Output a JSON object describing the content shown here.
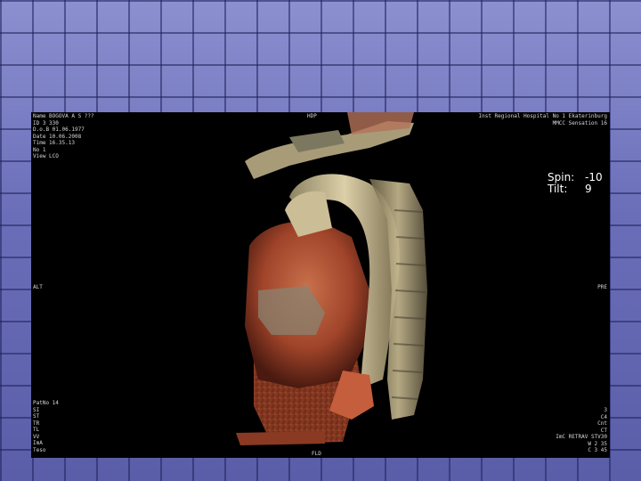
{
  "overlay": {
    "top_left": [
      "Name BOGOVA A S ???",
      "ID 3 330",
      "D.o.B 01.06.1977",
      "Date 10.06.2008",
      "Time 16.35.13",
      "No 1",
      "View LCO"
    ],
    "top_center": "HDP",
    "top_right": [
      "Inst Regional Hospital No 1 Ekaterinburg",
      "MMCC Sensation 16",
      "",
      "",
      "",
      ""
    ],
    "spin_label": "Spin:",
    "spin_value": "-10",
    "tilt_label": "Tilt:",
    "tilt_value": "9",
    "left_mid": "ALT",
    "right_mid": "PRE",
    "bottom_left": [
      "PatNo 14",
      "SI",
      "ST",
      "TR",
      "TL",
      "VV",
      "ImA",
      "Teso"
    ],
    "bottom_center": "FLD",
    "bottom_right": [
      "3",
      "C4",
      "Cnt",
      "CT",
      "ImC RETRAV STV30",
      "W 2 35",
      "C 3 45"
    ]
  },
  "colors": {
    "background": "#5a5ea8",
    "viewport": "#000000",
    "tissue_red": "#a0442a",
    "tissue_orange": "#c56a45",
    "vessel_cream": "#cfc19a",
    "bone": "#b8a888"
  }
}
